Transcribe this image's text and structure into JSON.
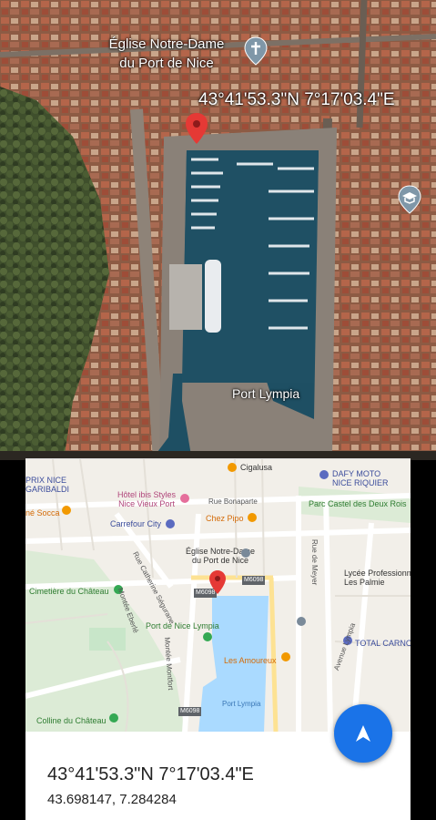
{
  "satellite": {
    "church_label_line1": "Église Notre-Dame",
    "church_label_line2": "du Port de Nice",
    "coordinates_overlay": "43°41'53.3\"N 7°17'03.4\"E",
    "port_label": "Port Lympia"
  },
  "map": {
    "labels": {
      "prix_nice": "PRIX NICE",
      "garibaldi": "GARIBALDI",
      "hotel_ibis_line1": "Hôtel ibis Styles",
      "hotel_ibis_line2": "Nice Vieux Port",
      "cigalusa": "Cigalusa",
      "dafy_line1": "DAFY MOTO",
      "dafy_line2": "NICE RIQUIER",
      "rue_bonaparte": "Rue Bonaparte",
      "parc_castel": "Parc Castel des Deux Rois",
      "ne_socca": "né Socca",
      "carrefour": "Carrefour City",
      "chez_pipo": "Chez Pipo",
      "rue_de_meyer": "Rue de Meyer",
      "rue_cath_segurane": "Rue Catherine Ségurane",
      "eglise_line1": "Église Notre-Dame",
      "eglise_line2": "du Port de Nice",
      "lycee_line1": "Lycée Professionn",
      "lycee_line2": "Les Palmie",
      "cimetiere": "Cimetière du Château",
      "montee_eberle": "Montée Eberlé",
      "m6098_a": "M6098",
      "m6098_b": "M6098",
      "m6098_c": "M6098",
      "port_nice_lympia": "Port de Nice Lympia",
      "montee_montfort": "Montée Montfort",
      "total": "TOTAL CARNO",
      "les_amoureux": "Les Amoureux",
      "avenue_lympia": "Avenue Lympia",
      "port_lympia": "Port Lympia",
      "colline_line1": "Colline du Château"
    }
  },
  "sheet": {
    "title": "43°41'53.3\"N 7°17'03.4\"E",
    "decimal": "43.698147, 7.284284"
  },
  "fab": {
    "icon": "navigation-arrow-icon",
    "color": "#1a73e8"
  },
  "colors": {
    "pin": "#e53935",
    "water": "#aadaff",
    "fab": "#1a73e8"
  }
}
